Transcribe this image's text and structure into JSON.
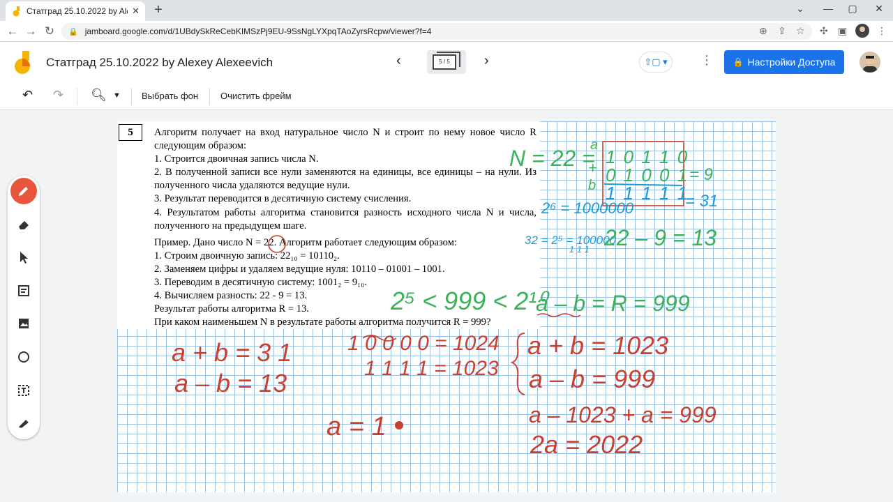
{
  "browser": {
    "tab_title": "Статград 25.10.2022 by Alexey Al",
    "tab_close": "✕",
    "new_tab": "+",
    "url": "jamboard.google.com/d/1UBdySkReCebKIMSzPj9EU-9SsNgLYXpqTAoZyrsRcpw/viewer?f=4"
  },
  "app": {
    "doc_title": "Статград 25.10.2022 by Alexey Alexeevich",
    "frame_indicator": "5 / 5",
    "share_label": "Настройки Доступа"
  },
  "toolbar": {
    "set_background": "Выбрать фон",
    "clear_frame": "Очистить фрейм"
  },
  "problem": {
    "number": "5",
    "lines": [
      "Алгоритм получает на вход натуральное число N и строит по нему новое число R следующим образом:",
      "1.  Строится двоичная запись числа N.",
      "2.  В полученной записи все нули заменяются на единицы, все единицы – на нули. Из полученного числа удаляются ведущие нули.",
      "3.  Результат переводится в десятичную систему счисления.",
      "4.  Результатом работы алгоритма становится разность исходного числа N и числа, полученного на предыдущем шаге."
    ],
    "example_intro": "Пример. Дано число N = 22. Алгоритм работает следующим образом:",
    "example_lines": [
      "1.  Строим двоичную запись: 22₁₀ = 10110₂.",
      "2.  Заменяем цифры и удаляем ведущие нуля: 10110 – 01001 – 1001.",
      "3.  Переводим в десятичную систему: 1001₂ = 9₁₀.",
      "4.  Вычисляем разность: 22 - 9 = 13.",
      "Результат работы алгоритма R = 13.",
      "При каком наименьшем N в результате работы алгоритма получится R = 999?"
    ]
  },
  "handwriting": {
    "green_n22": "N = 22 =",
    "letter_a": "a",
    "plus": "+",
    "letter_b": "b",
    "bin_row1": "1 0 1 1 0",
    "bin_row2": "0 1 0 0 1",
    "bin_row3": "1 1 1 1 1",
    "eq9": "= 9",
    "eq31": "= 31",
    "pow6": "2⁶ = 1000000",
    "pow6b": "32 = 2⁵ = 100000",
    "ones": "1 1 1",
    "diff": "22 – 9 = 13",
    "ineq": "2⁵ < 999 < 2¹⁰",
    "amb": "a – b =  R = 999",
    "sum31": "a + b = 3 1",
    "diff13": "a – b = 13",
    "p1024": "1 0 0 0 0 = 1024",
    "p1023": "1 1 1 1 = 1023",
    "sys1": "a + b = 1023",
    "sys2": "a – b = 999",
    "eq3": "a – 1023 + a = 999",
    "eq4": "2a = 2022",
    "ans": "a = 1",
    "colors": {
      "green": "#3bb25a",
      "blue": "#1c9bd8",
      "red": "#c8402f"
    }
  }
}
